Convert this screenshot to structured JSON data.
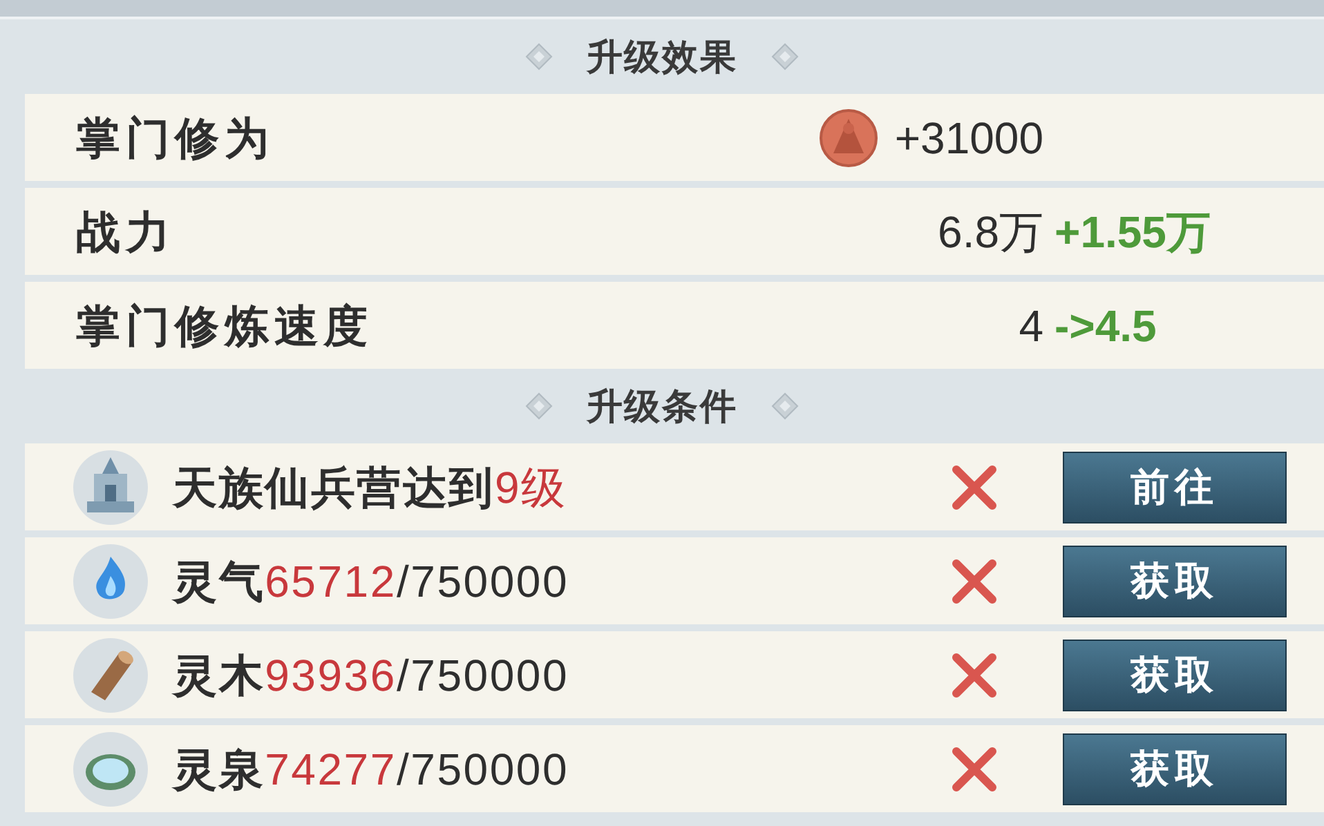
{
  "effects_header": {
    "title": "升级效果"
  },
  "effects": [
    {
      "label": "掌门修为",
      "kind": "reward",
      "value": "+31000"
    },
    {
      "label": "战力",
      "kind": "change",
      "current": "6.8万",
      "gain": "+1.55万"
    },
    {
      "label": "掌门修炼速度",
      "kind": "change",
      "current": "4",
      "gain": "->4.5"
    }
  ],
  "conditions_header": {
    "title": "升级条件"
  },
  "conditions": [
    {
      "label": "天族仙兵营达到",
      "progress": "9级",
      "met": false,
      "button": "前往"
    },
    {
      "label": "灵气",
      "progress": "65712",
      "total": "/750000",
      "met": false,
      "button": "获取"
    },
    {
      "label": "灵木",
      "progress": "93936",
      "total": "/750000",
      "met": false,
      "button": "获取"
    },
    {
      "label": "灵泉",
      "progress": "74277",
      "total": "/750000",
      "met": false,
      "button": "获取"
    }
  ]
}
